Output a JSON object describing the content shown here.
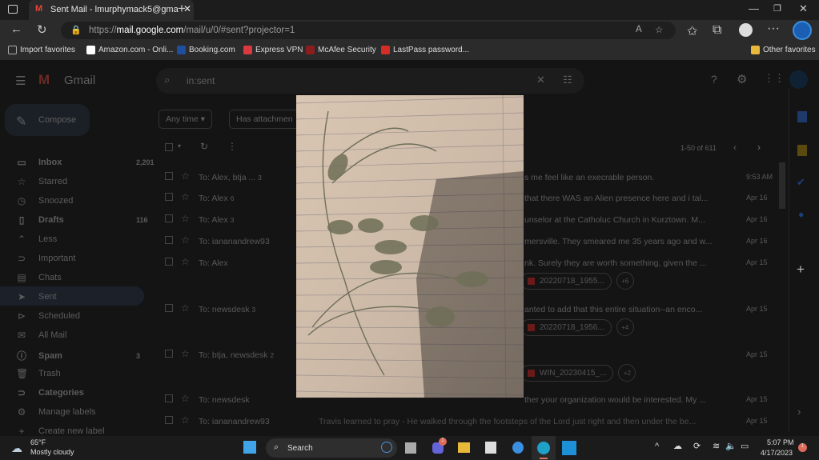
{
  "browser": {
    "tab_title": "Sent Mail - lmurphymack5@gma",
    "url_prefix": "https://",
    "url_host": "mail.google.com",
    "url_path": "/mail/u/0/#sent?projector=1",
    "bookmarks": [
      "Import favorites",
      "Amazon.com - Onli...",
      "Booking.com",
      "Express VPN",
      "McAfee Security",
      "LastPass password..."
    ],
    "other_favorites": "Other favorites"
  },
  "gmail": {
    "logo": "Gmail",
    "search": "in:sent",
    "compose": "Compose",
    "filters": [
      "Any time",
      "Has attachmen"
    ],
    "pagination": "1-50 of 611",
    "nav": [
      {
        "label": "Inbox",
        "count": "2,201",
        "icon": "inbox",
        "bold": true
      },
      {
        "label": "Starred",
        "icon": "☆"
      },
      {
        "label": "Snoozed",
        "icon": "◷"
      },
      {
        "label": "Drafts",
        "count": "116",
        "icon": "▯",
        "bold": true
      },
      {
        "label": "Less",
        "icon": "⌃"
      },
      {
        "label": "Important",
        "icon": "⊃"
      },
      {
        "label": "Chats",
        "icon": "▤"
      },
      {
        "label": "Sent",
        "icon": "➤",
        "active": true
      },
      {
        "label": "Scheduled",
        "icon": "⊳"
      },
      {
        "label": "All Mail",
        "icon": "✉"
      },
      {
        "label": "Spam",
        "count": "3",
        "icon": "ⓘ",
        "bold": true
      },
      {
        "label": "Trash",
        "icon": "🗑"
      },
      {
        "label": "Categories",
        "icon": "⊃",
        "bold": true
      },
      {
        "label": "Manage labels",
        "icon": "⚙"
      },
      {
        "label": "Create new label",
        "icon": "+"
      }
    ],
    "emails": [
      {
        "to": "To: Alex, btja ...",
        "n": "3",
        "snippet": "s me feel like an execrable person.",
        "date": "9:53 AM"
      },
      {
        "to": "To: Alex",
        "n": "6",
        "snippet": "that there WAS an Alien presence here and i tal...",
        "date": "Apr 16"
      },
      {
        "to": "To: Alex",
        "n": "3",
        "snippet": "unselor at the Catholuc Church in Kurztown. M...",
        "date": "Apr 16"
      },
      {
        "to": "To: iananandrew93",
        "n": "",
        "snippet": "mersville. They smeared me 35 years ago and w...",
        "date": "Apr 16"
      },
      {
        "to": "To: Alex",
        "n": "",
        "snippet": "nk. Surely they are worth something, given the ...",
        "date": "Apr 15",
        "attachment": "20220718_1955...",
        "more": "+6"
      },
      {
        "to": "To: newsdesk",
        "n": "3",
        "snippet": "anted to add that this entire situation--an enco...",
        "date": "Apr 15",
        "attachment": "20220718_1956...",
        "more": "+4"
      },
      {
        "to": "To: btja, newsdesk",
        "n": "2",
        "snippet": "",
        "date": "Apr 15",
        "attachment": "WIN_20230415_...",
        "more": "+2"
      },
      {
        "to": "To: newsdesk",
        "n": "",
        "snippet": "ther your organization would be interested. My ...",
        "date": "Apr 15"
      },
      {
        "to": "To: iananandrew93",
        "n": "",
        "subject": "Travis learned to pray",
        "snippet": " - He walked through the footsteps of the Lord just right and then under the be...",
        "date": "Apr 15"
      }
    ]
  },
  "taskbar": {
    "temp": "65°F",
    "weather": "Mostly cloudy",
    "search": "Search",
    "time": "5:07 PM",
    "date": "4/17/2023",
    "chat_badge": "1",
    "notif_badge": "1"
  }
}
